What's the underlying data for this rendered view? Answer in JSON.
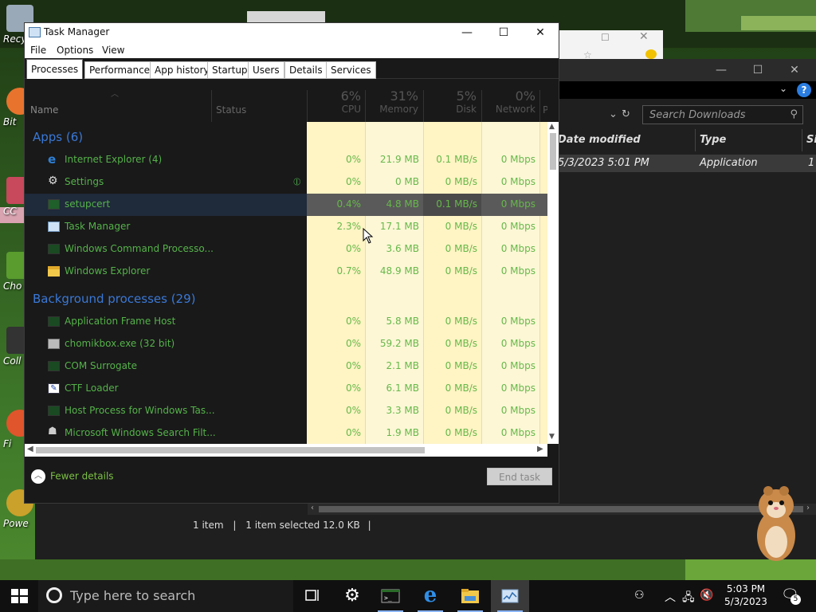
{
  "desktop": {
    "icons": [
      {
        "label": "Recy"
      },
      {
        "label": "Bit"
      },
      {
        "label": "CC"
      },
      {
        "label": "Cho"
      },
      {
        "label": "Coll"
      },
      {
        "label": "Fi"
      },
      {
        "label": "Powe"
      }
    ]
  },
  "explorer": {
    "search_placeholder": "Search Downloads",
    "columns": [
      "Date modified",
      "Type",
      "Size"
    ],
    "row": {
      "date": "5/3/2023 5:01 PM",
      "type": "Application",
      "size": "1"
    },
    "status": {
      "items": "1 item",
      "selected": "1 item selected  12.0 KB"
    }
  },
  "taskmanager": {
    "title": "Task Manager",
    "menu": [
      "File",
      "Options",
      "View"
    ],
    "tabs": [
      "Processes",
      "Performance",
      "App history",
      "Startup",
      "Users",
      "Details",
      "Services"
    ],
    "active_tab": "Processes",
    "columns": {
      "name": "Name",
      "status": "Status",
      "cpu": {
        "pct": "6%",
        "label": "CPU"
      },
      "memory": {
        "pct": "31%",
        "label": "Memory"
      },
      "disk": {
        "pct": "5%",
        "label": "Disk"
      },
      "network": {
        "pct": "0%",
        "label": "Network"
      },
      "power": "Po"
    },
    "groups": [
      {
        "label": "Apps (6)",
        "rows": [
          {
            "name": "Internet Explorer (4)",
            "cpu": "0%",
            "mem": "21.9 MB",
            "disk": "0.1 MB/s",
            "net": "0 Mbps",
            "icon": "ie-icon"
          },
          {
            "name": "Settings",
            "cpu": "0%",
            "mem": "0 MB",
            "disk": "0 MB/s",
            "net": "0 Mbps",
            "icon": "gear-icon",
            "leaf": true
          },
          {
            "name": "setupcert",
            "cpu": "0.4%",
            "mem": "4.8 MB",
            "disk": "0.1 MB/s",
            "net": "0 Mbps",
            "icon": "app-icon",
            "selected": true
          },
          {
            "name": "Task Manager",
            "cpu": "2.3%",
            "mem": "17.1 MB",
            "disk": "0 MB/s",
            "net": "0 Mbps",
            "icon": "taskmgr-icon"
          },
          {
            "name": "Windows Command Processo...",
            "cpu": "0%",
            "mem": "3.6 MB",
            "disk": "0 MB/s",
            "net": "0 Mbps",
            "icon": "cmd-icon"
          },
          {
            "name": "Windows Explorer",
            "cpu": "0.7%",
            "mem": "48.9 MB",
            "disk": "0 MB/s",
            "net": "0 Mbps",
            "icon": "folder-icon"
          }
        ]
      },
      {
        "label": "Background processes (29)",
        "rows": [
          {
            "name": "Application Frame Host",
            "cpu": "0%",
            "mem": "5.8 MB",
            "disk": "0 MB/s",
            "net": "0 Mbps",
            "icon": "app-icon"
          },
          {
            "name": "chomikbox.exe (32 bit)",
            "cpu": "0%",
            "mem": "59.2 MB",
            "disk": "0 MB/s",
            "net": "0 Mbps",
            "icon": "chomikbox-icon"
          },
          {
            "name": "COM Surrogate",
            "cpu": "0%",
            "mem": "2.1 MB",
            "disk": "0 MB/s",
            "net": "0 Mbps",
            "icon": "app-icon"
          },
          {
            "name": "CTF Loader",
            "cpu": "0%",
            "mem": "6.1 MB",
            "disk": "0 MB/s",
            "net": "0 Mbps",
            "icon": "ctf-icon"
          },
          {
            "name": "Host Process for Windows Tas...",
            "cpu": "0%",
            "mem": "3.3 MB",
            "disk": "0 MB/s",
            "net": "0 Mbps",
            "icon": "app-icon"
          },
          {
            "name": "Microsoft Windows Search Filt...",
            "cpu": "0%",
            "mem": "1.9 MB",
            "disk": "0 MB/s",
            "net": "0 Mbps",
            "icon": "search-filter-icon"
          }
        ]
      }
    ],
    "fewer_details": "Fewer details",
    "end_task": "End task"
  },
  "taskbar": {
    "search_placeholder": "Type here to search",
    "time": "5:03 PM",
    "date": "5/3/2023",
    "notifications": "5"
  },
  "colors": {
    "cpu_heat": "#fff4c4",
    "heat_light": "#fdf7d6",
    "group_blue": "#3a78d6",
    "name_green": "#55b24a"
  }
}
